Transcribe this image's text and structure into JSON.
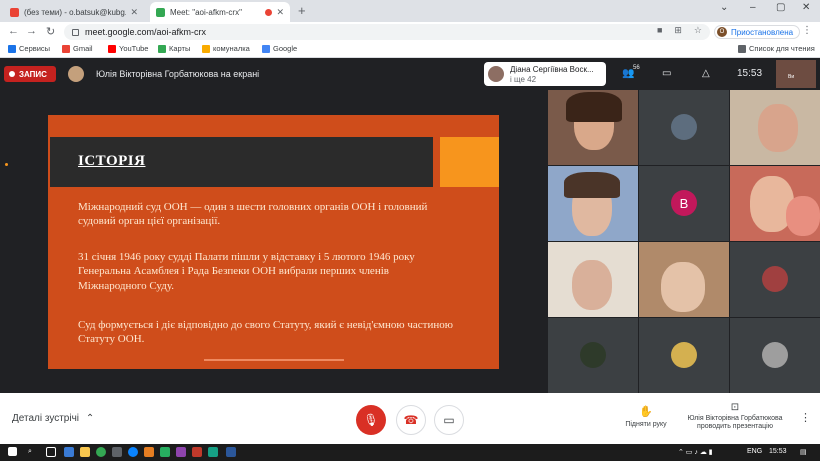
{
  "browser": {
    "tabs": [
      {
        "title": "(без теми) - o.batsuk@kubg.edu",
        "favicon_color": "#ea4335"
      },
      {
        "title": "Meet: \"aoi-afkm-crx\"",
        "favicon_color": "#34a853"
      }
    ],
    "new_tab_glyph": "+",
    "url": "meet.google.com/aoi-afkm-crx",
    "profile_initial": "O",
    "profile_label": "Приостановлена",
    "reading_list": "Список для чтения"
  },
  "bookmarks": [
    {
      "label": "Сервисы",
      "color": "#1a73e8"
    },
    {
      "label": "Gmail",
      "color": "#ea4335"
    },
    {
      "label": "YouTube",
      "color": "#ff0000"
    },
    {
      "label": "Карты",
      "color": "#34a853"
    },
    {
      "label": "комуналка",
      "color": "#f9ab00"
    },
    {
      "label": "Google",
      "color": "#4285f4"
    }
  ],
  "meet": {
    "record_label": "ЗАПИС",
    "presenter_label": "Юлія Вікторівна Горбатюкова на екрані",
    "active_speaker": {
      "name": "Діана Сергіївна Воск...",
      "more": "і ще 42"
    },
    "participant_count": "56",
    "time": "15:53",
    "self_label": "Ви"
  },
  "slide": {
    "title": "ІСТОРІЯ",
    "paragraphs": [
      "Міжнародний суд ООН — один з шести головних органів ООН і головний судовий орган цієї організації.",
      "31 січня 1946 року судді Палати пішли у відставку і 5 лютого 1946 року Генеральна Асамблея і Рада Безпеки ООН вибрали перших членів Міжнародного Суду.",
      "Суд формується і діє відповідно до свого Статуту, який є невід'ємною частиною Статуту ООН."
    ]
  },
  "participants": {
    "avatar_letter": "B"
  },
  "bottom": {
    "details_label": "Деталі зустрічі",
    "raise_hand": "Підняти руку",
    "presenter_status": "Юлія Вікторівна Горбатюкова проводить презентацію"
  },
  "taskbar": {
    "lang": "ENG",
    "time": "15:53"
  }
}
